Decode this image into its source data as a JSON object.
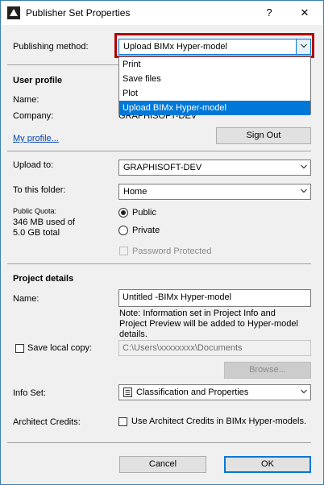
{
  "window": {
    "title": "Publisher Set Properties",
    "help_glyph": "?",
    "close_glyph": "✕"
  },
  "publishing": {
    "label": "Publishing method:",
    "selected": "Upload BIMx Hyper-model",
    "options": [
      "Print",
      "Save files",
      "Plot",
      "Upload BIMx Hyper-model"
    ]
  },
  "user_profile": {
    "heading": "User profile",
    "name_label": "Name:",
    "company_label": "Company:",
    "company_value": "GRAPHISOFT-DEV",
    "my_profile_link": "My profile...",
    "sign_out_button": "Sign Out"
  },
  "upload": {
    "upload_to_label": "Upload to:",
    "upload_to_value": "GRAPHISOFT-DEV",
    "folder_label": "To this folder:",
    "folder_value": "Home",
    "quota_label": "Public Quota:",
    "quota_value_line1": "346 MB used of",
    "quota_value_line2": "5.0 GB total",
    "public_label": "Public",
    "private_label": "Private",
    "password_label": "Password Protected"
  },
  "project": {
    "heading": "Project details",
    "name_label": "Name:",
    "name_value": "Untitled -BIMx Hyper-model",
    "note_line1": "Note: Information set in Project Info and",
    "note_line2": "Project Preview will be added to Hyper-model",
    "note_line3": "details.",
    "save_local_label": "Save local copy:",
    "local_path": "C:\\Users\\xxxxxxxx\\Documents",
    "browse_button": "Browse...",
    "info_set_label": "Info Set:",
    "info_set_value": "Classification and Properties",
    "credits_label": "Architect Credits:",
    "credits_checkbox_label": "Use Architect Credits in BIMx Hyper-models."
  },
  "footer": {
    "cancel_button": "Cancel",
    "ok_button": "OK"
  },
  "colors": {
    "accent": "#0078d7",
    "highlight_border": "#b30000"
  }
}
